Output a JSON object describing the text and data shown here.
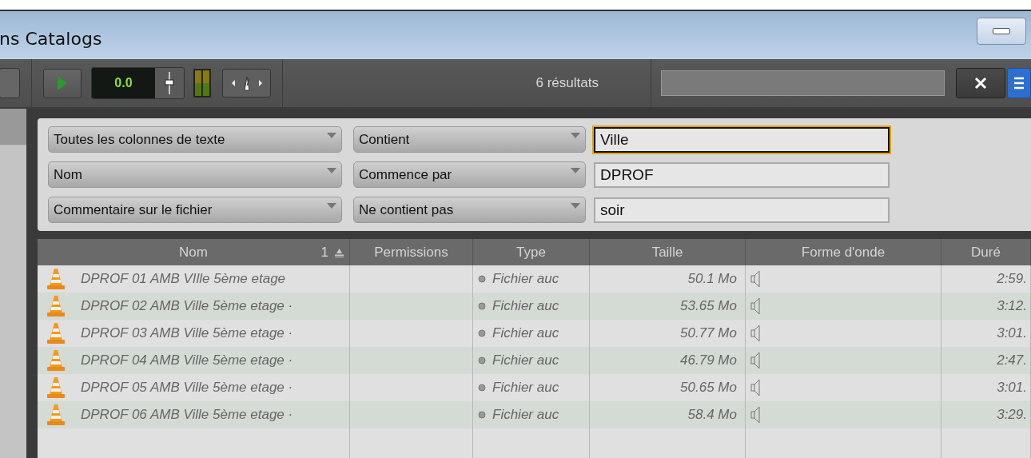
{
  "window": {
    "title": "ns Catalogs"
  },
  "toolbar": {
    "counter": "0.0",
    "results": "6 résultats"
  },
  "filters": [
    {
      "field": "Toutes les colonnes de texte",
      "operator": "Contient",
      "value": "Ville",
      "focused": true
    },
    {
      "field": "Nom",
      "operator": "Commence par",
      "value": "DPROF",
      "focused": false
    },
    {
      "field": "Commentaire sur le fichier",
      "operator": "Ne contient pas",
      "value": "soir",
      "focused": false
    }
  ],
  "table": {
    "columns": [
      {
        "label": "Nom",
        "sort_index": "1"
      },
      {
        "label": "Permissions"
      },
      {
        "label": "Type"
      },
      {
        "label": "Taille"
      },
      {
        "label": "Forme d'onde"
      },
      {
        "label": "Duré"
      }
    ],
    "rows": [
      {
        "name": "DPROF 01 AMB VIlle 5ème etage",
        "type": "Fichier auc",
        "size": "50.1 Mo",
        "duration": "2:59."
      },
      {
        "name": "DPROF 02 AMB Ville 5ème etage ·",
        "type": "Fichier auc",
        "size": "53.65 Mo",
        "duration": "3:12."
      },
      {
        "name": "DPROF 03 AMB Ville 5ème etage ·",
        "type": "Fichier auc",
        "size": "50.77 Mo",
        "duration": "3:01."
      },
      {
        "name": "DPROF 04 AMB Ville 5ème etage ·",
        "type": "Fichier auc",
        "size": "46.79 Mo",
        "duration": "2:47."
      },
      {
        "name": "DPROF 05 AMB Ville 5ème etage ·",
        "type": "Fichier auc",
        "size": "50.65 Mo",
        "duration": "3:01."
      },
      {
        "name": "DPROF 06 AMB Ville 5ème etage ·",
        "type": "Fichier auc",
        "size": "58.4 Mo",
        "duration": "3:29."
      }
    ]
  }
}
